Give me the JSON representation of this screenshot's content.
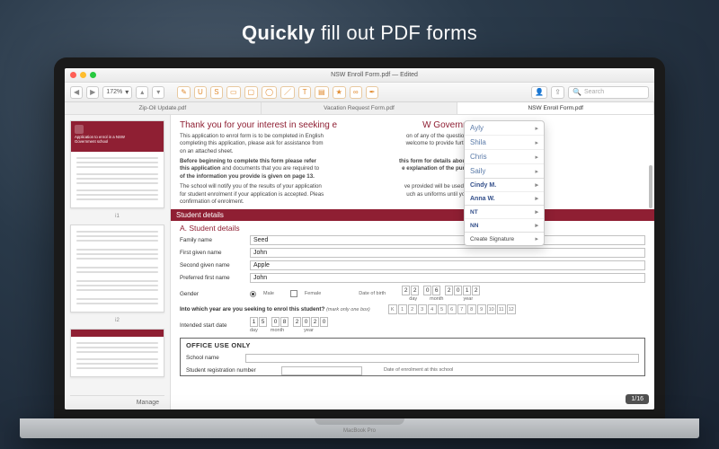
{
  "headline_bold": "Quickly",
  "headline_rest": " fill out PDF forms",
  "laptop_label": "MacBook Pro",
  "window": {
    "title": "NSW Enroll Form.pdf — Edited",
    "zoom": "172%",
    "search_placeholder": "Search"
  },
  "toolbar_icons": [
    "nav-back",
    "nav-fwd",
    "zoom",
    "pen",
    "underline",
    "strike",
    "highlight",
    "rect",
    "oval",
    "line",
    "text",
    "note",
    "stamp",
    "link",
    "signature",
    "share"
  ],
  "tabs": [
    {
      "label": "Zip-Oil Update.pdf",
      "active": false
    },
    {
      "label": "Vacation Request Form.pdf",
      "active": false
    },
    {
      "label": "NSW Enroll Form.pdf",
      "active": true
    }
  ],
  "thumbnails": {
    "logo_text": "Application to enrol in a NSW Government school",
    "labels": [
      "i1",
      "i2",
      ""
    ]
  },
  "sidebar_manage": "Manage",
  "page_badge": "1/16",
  "sig_menu": {
    "scripted": [
      "Ayly",
      "Shila",
      "Chris",
      "Saily"
    ],
    "handwritten": [
      "Cindy M.",
      "Anna W."
    ],
    "initials": [
      "NT",
      "NN"
    ],
    "create": "Create Signature"
  },
  "doc": {
    "h1_left": "Thank you for your interest in seeking e",
    "h1_right": "W Government school.",
    "p1": "This application to enrol form is to be completed in English",
    "p1b": "on of any of the questions or help in",
    "p2": "completing this application, please ask for assistance from",
    "p2b": "welcome to provide further information",
    "p3": "on an attached sheet.",
    "boldp_a": "Before beginning to complete this form please refer",
    "boldp_a2": "this form for details about completing",
    "boldp_b": "this application",
    "boldp_b2": " and documents that you are required to",
    "boldp_b3": "e explanation of the purpose and use",
    "boldp_c": "of the information you provide is given on page 13.",
    "p4a": "The school will notify you of the results of your application",
    "p4a2": "ve provided will be used by the school",
    "p4b": "for student enrolment if your application is accepted. Pleas",
    "p4b2": "uch as uniforms until you receive",
    "p4c": "confirmation of enrolment.",
    "section": "Student details",
    "subh": "A. Student details",
    "labels": {
      "family": "Family name",
      "first": "First given name",
      "second": "Second given name",
      "pref": "Preferred first name",
      "gender": "Gender",
      "male": "Male",
      "female": "Female",
      "dob": "Date of birth",
      "enrol_q": "Into which year are you seeking to enrol this student?",
      "enrol_hint": "(mark only one box)",
      "intended": "Intended start date",
      "office": "OFFICE USE ONLY",
      "schoolname": "School name",
      "srn": "Student registration number",
      "doe": "Date of enrolment at this school",
      "day": "day",
      "month": "month",
      "year": "year"
    },
    "values": {
      "family": "Seed",
      "first": "John",
      "second": "Apple",
      "pref": "John",
      "dob": [
        "2",
        "2",
        "0",
        "6",
        "2",
        "0",
        "1",
        "2"
      ],
      "enrol_levels": [
        "K",
        "1",
        "2",
        "3",
        "4",
        "5",
        "6",
        "7",
        "8",
        "9",
        "10",
        "11",
        "12"
      ],
      "intended": [
        "1",
        "5",
        "0",
        "8",
        "2",
        "0",
        "2",
        "0"
      ]
    }
  }
}
